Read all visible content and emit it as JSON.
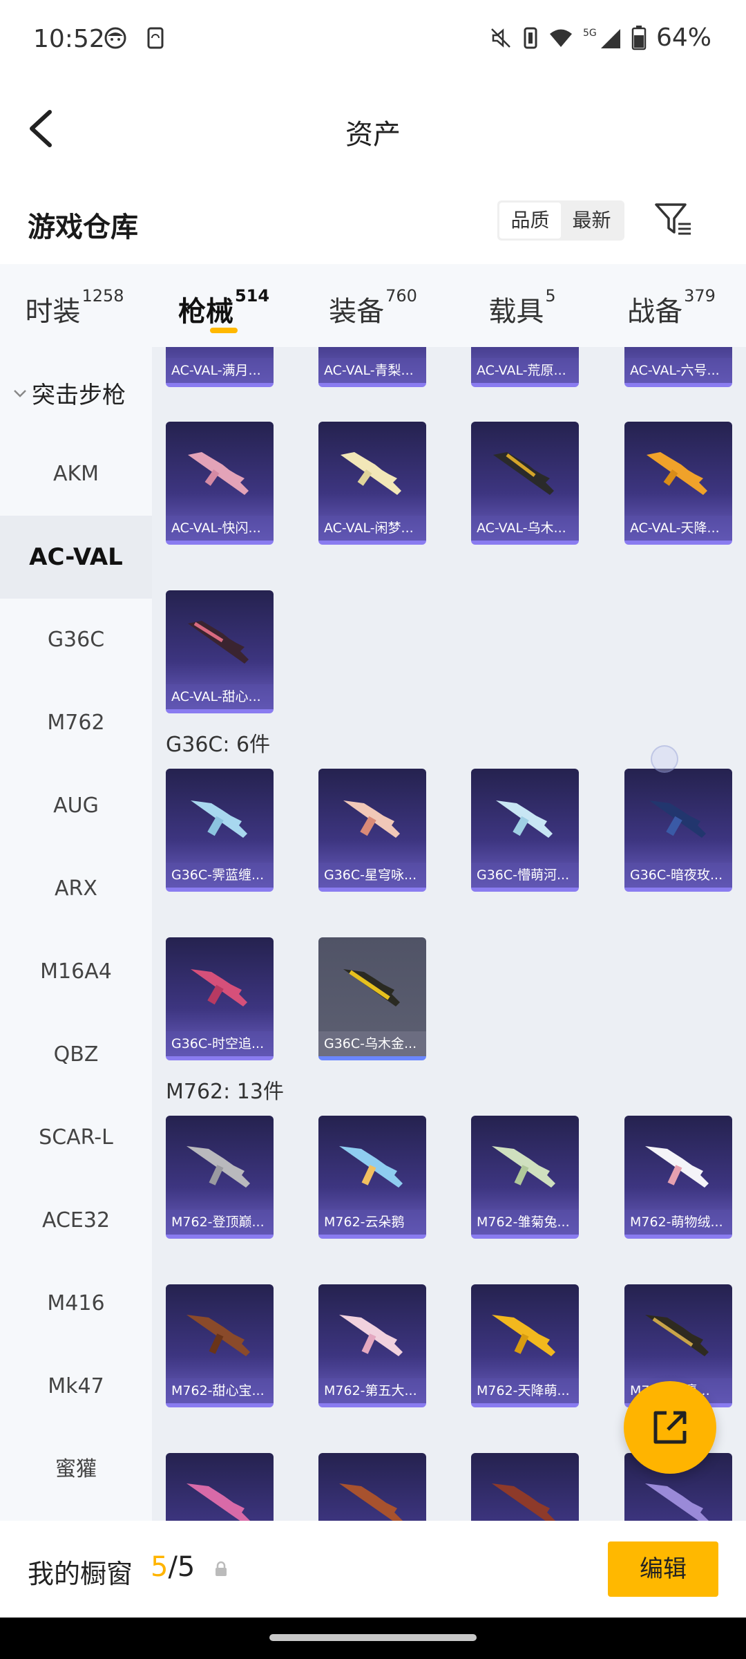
{
  "status_bar": {
    "time": "10:52",
    "battery": "64%",
    "icons": [
      "face-icon",
      "phone-sync-icon",
      "mute-icon",
      "vibrate-icon",
      "wifi-icon",
      "5g-signal-icon",
      "battery-icon"
    ]
  },
  "header": {
    "title": "资产"
  },
  "warehouse": {
    "title": "游戏仓库",
    "sort_options": [
      "品质",
      "最新"
    ],
    "sort_active": "品质"
  },
  "tabs": [
    {
      "label": "时装",
      "count": "1258"
    },
    {
      "label": "枪械",
      "count": "514",
      "active": true
    },
    {
      "label": "装备",
      "count": "760"
    },
    {
      "label": "载具",
      "count": "5"
    },
    {
      "label": "战备",
      "count": "379"
    }
  ],
  "sidebar": {
    "category": "突击步枪",
    "items": [
      "AKM",
      "AC-VAL",
      "G36C",
      "M762",
      "AUG",
      "ARX",
      "M16A4",
      "QBZ",
      "SCAR-L",
      "ACE32",
      "M416",
      "Mk47",
      "蜜獾"
    ],
    "active": "AC-VAL"
  },
  "sections": {
    "top_row": [
      "AC-VAL-满月...",
      "AC-VAL-青梨...",
      "AC-VAL-荒原...",
      "AC-VAL-六号..."
    ],
    "acval_row2": [
      "AC-VAL-快闪...",
      "AC-VAL-闲梦...",
      "AC-VAL-乌木...",
      "AC-VAL-天降..."
    ],
    "acval_row3": [
      "AC-VAL-甜心..."
    ],
    "g36c_title": "G36C: 6件",
    "g36c_row1": [
      "G36C-霁蓝缠...",
      "G36C-星穹咏...",
      "G36C-懵萌河...",
      "G36C-暗夜玫..."
    ],
    "g36c_row2": [
      "G36C-时空追...",
      "G36C-乌木金..."
    ],
    "m762_title": "M762: 13件",
    "m762_row1": [
      "M762-登顶巅...",
      "M762-云朵鹅",
      "M762-雏菊兔...",
      "M762-萌物绒..."
    ],
    "m762_row2": [
      "M762-甜心宝...",
      "M762-第五大...",
      "M762-天降萌...",
      "M762-夜瀛..."
    ]
  },
  "bottom": {
    "label": "我的橱窗",
    "current": "5",
    "total": "/5",
    "edit": "编辑"
  },
  "colors": {
    "accent": "#ffb800",
    "card_purple": "#3d3580",
    "card_gray": "#5d6072"
  }
}
